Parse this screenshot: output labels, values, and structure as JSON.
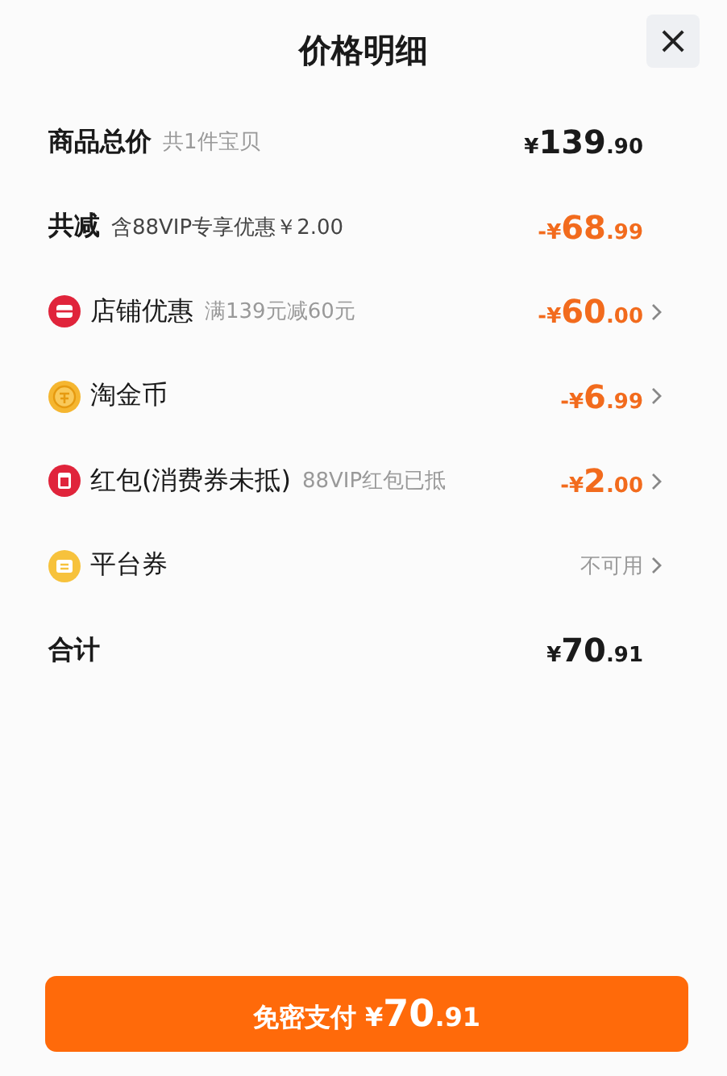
{
  "title": "价格明细",
  "close": "×",
  "rows": [
    {
      "kind": "summary",
      "label": "商品总价",
      "note": "共1件宝贝",
      "amount": {
        "sign": "¥",
        "integer": "139",
        "decimal": ".90"
      },
      "color": "#1a1a1a",
      "chevron": false
    },
    {
      "kind": "summary",
      "label": "共减",
      "note": "含88VIP专享优惠￥2.00",
      "amount": {
        "sign": "-¥",
        "integer": "68",
        "decimal": ".99"
      },
      "color": "#f26b1d",
      "chevron": false
    },
    {
      "kind": "shop",
      "label": "店铺优惠",
      "note": "满139元减60元",
      "amount": {
        "sign": "-¥",
        "integer": "60",
        "decimal": ".00"
      },
      "color": "#f26b1d",
      "chevron": true
    },
    {
      "kind": "coin",
      "label": "淘金币",
      "amount": {
        "sign": "-¥",
        "integer": "6",
        "decimal": ".99"
      },
      "color": "#f26b1d",
      "chevron": true
    },
    {
      "kind": "packet",
      "label": "红包(消费券未抵)",
      "note": "88VIP红包已抵",
      "amount": {
        "sign": "-¥",
        "integer": "2",
        "decimal": ".00"
      },
      "color": "#f26b1d",
      "chevron": true
    },
    {
      "kind": "coupon",
      "label": "平台券",
      "status": "不可用",
      "color": "#999999",
      "chevron": true
    },
    {
      "kind": "summary",
      "label": "合计",
      "amount": {
        "sign": "¥",
        "integer": "70",
        "decimal": ".91"
      },
      "color": "#1a1a1a",
      "chevron": false
    }
  ],
  "pay_button": {
    "label": "免密支付",
    "amount": {
      "sign": "¥",
      "integer": "70",
      "decimal": ".91"
    }
  }
}
